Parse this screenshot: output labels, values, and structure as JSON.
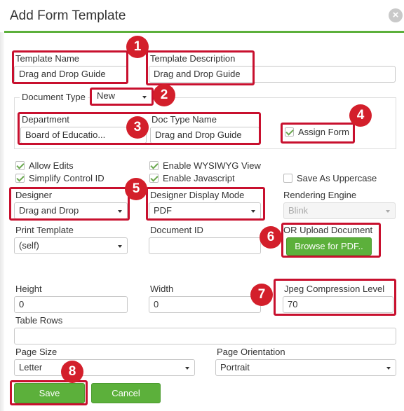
{
  "dialog": {
    "title": "Add Form Template",
    "close": "×"
  },
  "template_name": {
    "label": "Template Name",
    "value": "Drag and Drop Guide"
  },
  "template_description": {
    "label": "Template Description",
    "value": "Drag and Drop Guide"
  },
  "document_type": {
    "label": "Document Type",
    "value": "New"
  },
  "department": {
    "label": "Department",
    "value": "Board of Educatio..."
  },
  "doc_type_name": {
    "label": "Doc Type Name",
    "value": "Drag and Drop Guide"
  },
  "assign_form": {
    "label": "Assign Form",
    "checked": true
  },
  "options": {
    "allow_edits": {
      "label": "Allow Edits",
      "checked": true
    },
    "simplify_control_id": {
      "label": "Simplify Control ID",
      "checked": true
    },
    "enable_wysiwyg": {
      "label": "Enable WYSIWYG View",
      "checked": true
    },
    "enable_javascript": {
      "label": "Enable Javascript",
      "checked": true
    },
    "save_as_uppercase": {
      "label": "Save As Uppercase",
      "checked": false
    }
  },
  "designer": {
    "label": "Designer",
    "value": "Drag and Drop"
  },
  "designer_display_mode": {
    "label": "Designer Display Mode",
    "value": "PDF"
  },
  "rendering_engine": {
    "label": "Rendering Engine",
    "value": "Blink"
  },
  "print_template": {
    "label": "Print Template",
    "value": "(self)"
  },
  "document_id": {
    "label": "Document ID",
    "value": ""
  },
  "upload": {
    "label": "OR Upload Document",
    "button": "Browse for PDF.."
  },
  "height": {
    "label": "Height",
    "value": "0"
  },
  "width": {
    "label": "Width",
    "value": "0"
  },
  "jpeg_compression": {
    "label": "Jpeg Compression Level",
    "value": "70"
  },
  "table_rows": {
    "label": "Table Rows",
    "value": ""
  },
  "page_size": {
    "label": "Page Size",
    "value": "Letter"
  },
  "page_orientation": {
    "label": "Page Orientation",
    "value": "Portrait"
  },
  "actions": {
    "save": "Save",
    "cancel": "Cancel"
  },
  "annotations": [
    "1",
    "2",
    "3",
    "4",
    "5",
    "6",
    "7",
    "8"
  ],
  "colors": {
    "accent_green": "#5cb03b",
    "annotation_red": "#c8102e",
    "badge_red": "#d31f2b"
  }
}
